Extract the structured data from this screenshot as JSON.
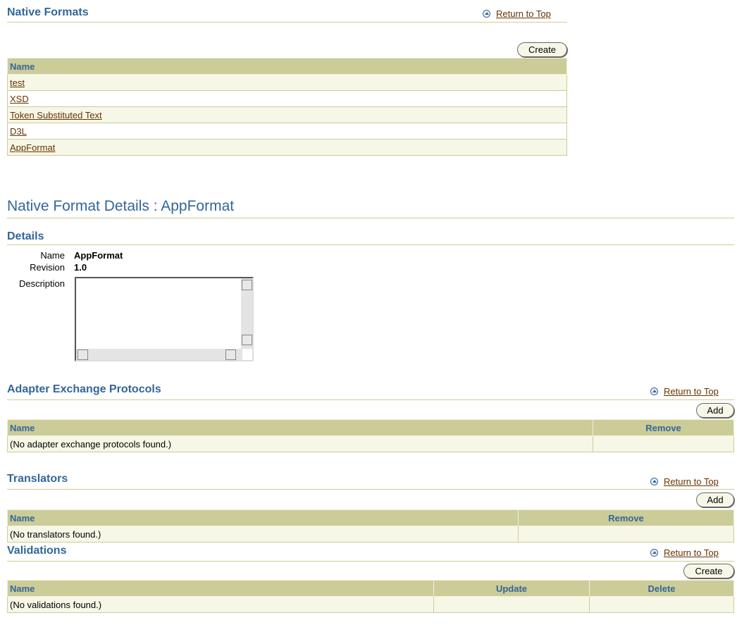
{
  "native_formats": {
    "title": "Native Formats",
    "return_to_top": "Return to Top",
    "create_label": "Create",
    "header_name": "Name",
    "rows": [
      "test",
      "XSD",
      "Token Substituted Text",
      "D3L",
      "AppFormat"
    ]
  },
  "details_page": {
    "title": "Native Format Details : AppFormat",
    "section_title": "Details",
    "name_label": "Name",
    "name_value": "AppFormat",
    "revision_label": "Revision",
    "revision_value": "1.0",
    "description_label": "Description",
    "description_value": ""
  },
  "adapter_protocols": {
    "title": "Adapter Exchange Protocols",
    "return_to_top": "Return to Top",
    "add_label": "Add",
    "header_name": "Name",
    "header_remove": "Remove",
    "empty_text": "(No adapter exchange protocols found.)"
  },
  "translators": {
    "title": "Translators",
    "return_to_top": "Return to Top",
    "add_label": "Add",
    "header_name": "Name",
    "header_remove": "Remove",
    "empty_text": "(No translators found.)"
  },
  "validations": {
    "title": "Validations",
    "return_to_top": "Return to Top",
    "create_label": "Create",
    "header_name": "Name",
    "header_update": "Update",
    "header_delete": "Delete",
    "empty_text": "(No validations found.)"
  },
  "colors": {
    "heading": "#336699",
    "link": "#663300",
    "table_header_bg": "#cccc99",
    "table_row_bg": "#f7f7e7"
  }
}
